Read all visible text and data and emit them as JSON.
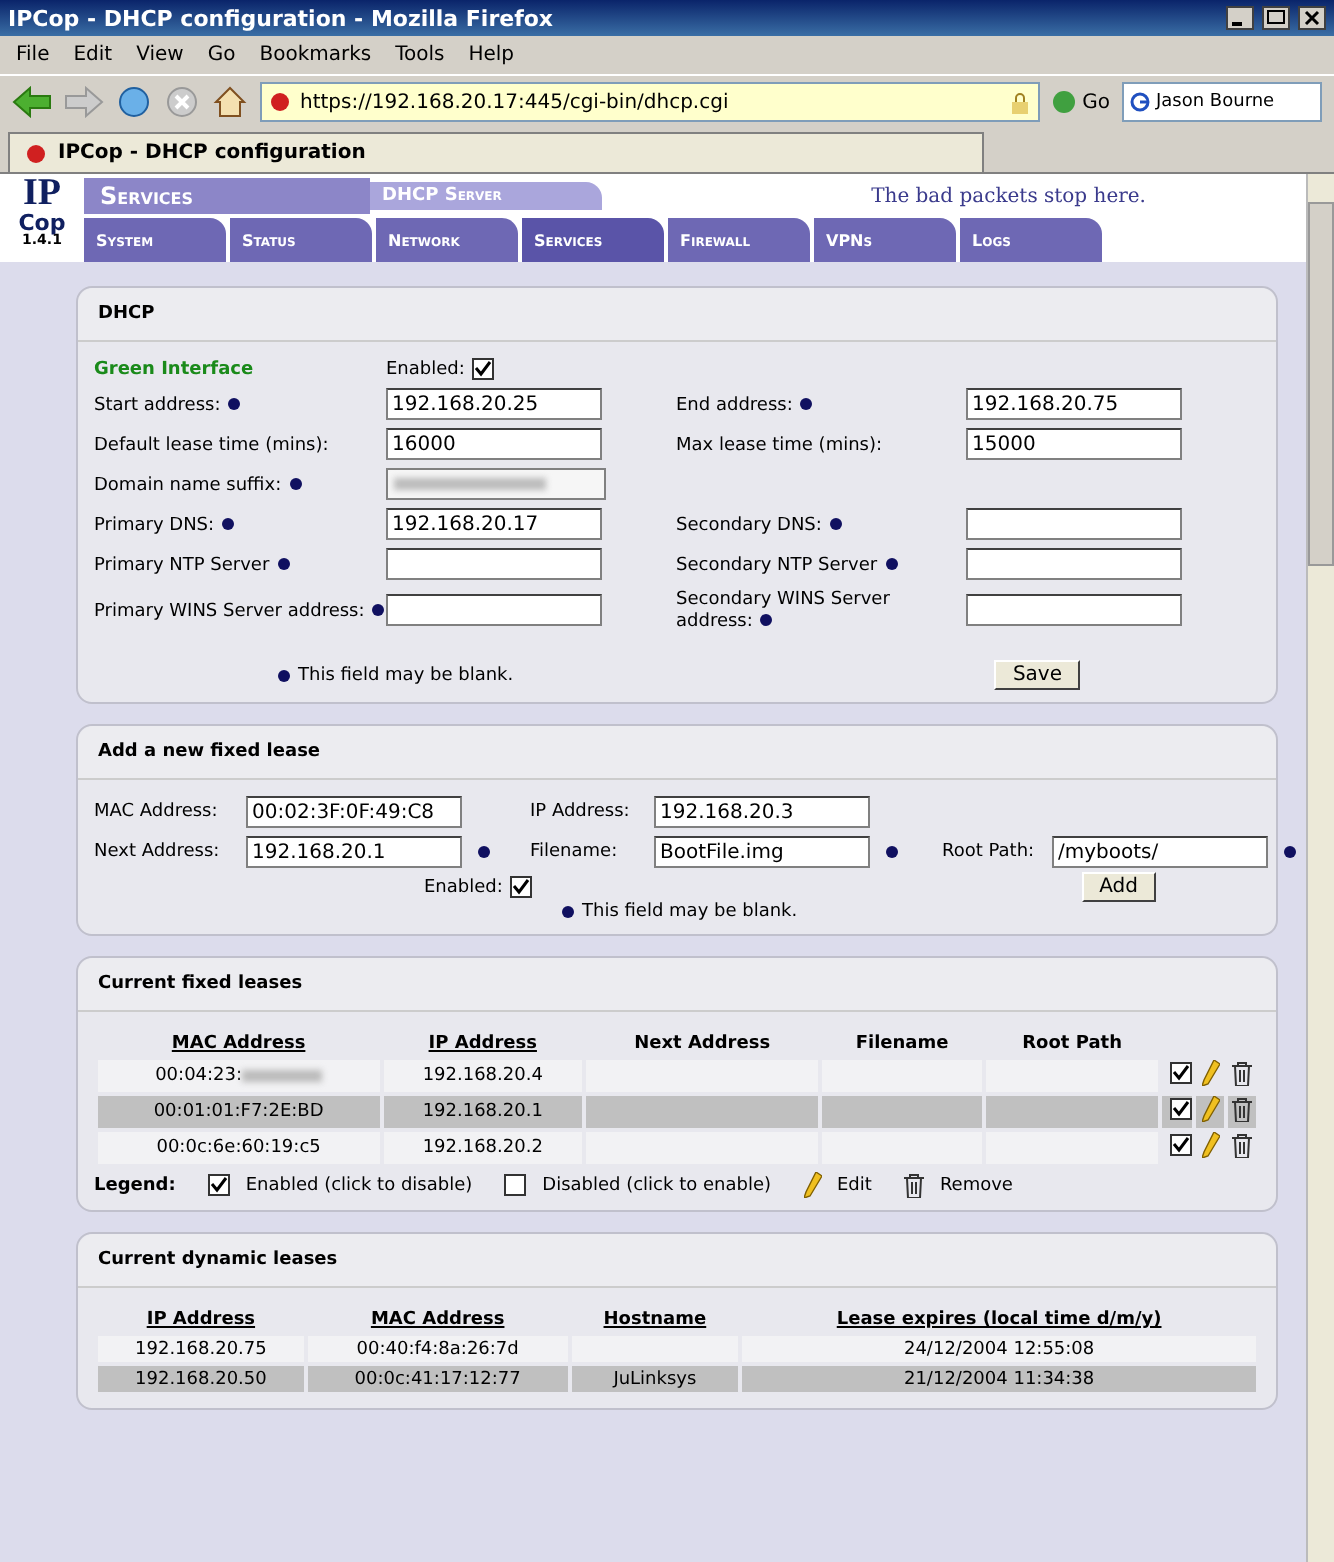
{
  "window": {
    "title": "IPCop - DHCP configuration - Mozilla Firefox"
  },
  "menu": [
    "File",
    "Edit",
    "View",
    "Go",
    "Bookmarks",
    "Tools",
    "Help"
  ],
  "toolbar": {
    "url": "https://192.168.20.17:445/cgi-bin/dhcp.cgi",
    "go": "Go",
    "search": "Jason Bourne"
  },
  "tabs": [
    {
      "label": "IPCop - DHCP configuration",
      "selected": true
    }
  ],
  "banner": {
    "logo_top": "IP",
    "logo_bottom": "Cop",
    "version": "1.4.1",
    "section": "Services",
    "subsection": "DHCP Server",
    "slogan": "The bad packets stop here.",
    "nav": [
      {
        "label": "System",
        "selected": false
      },
      {
        "label": "Status",
        "selected": false
      },
      {
        "label": "Network",
        "selected": false
      },
      {
        "label": "Services",
        "selected": true
      },
      {
        "label": "Firewall",
        "selected": false
      },
      {
        "label": "VPNs",
        "selected": false
      },
      {
        "label": "Logs",
        "selected": false
      }
    ]
  },
  "dhcp": {
    "title": "DHCP",
    "interface": "Green Interface",
    "enabled_label": "Enabled:",
    "enabled": true,
    "rows": [
      [
        {
          "label": "Start address:",
          "optional": true,
          "value": "192.168.20.25"
        },
        {
          "label": "End address:",
          "optional": true,
          "value": "192.168.20.75"
        }
      ],
      [
        {
          "label": "Default lease time (mins):",
          "value": "16000"
        },
        {
          "label": "Max lease time (mins):",
          "value": "15000"
        }
      ],
      [
        {
          "label": "Domain name suffix:",
          "optional": true,
          "blurred": true
        }
      ],
      [
        {
          "label": "Primary DNS:",
          "optional": true,
          "value": "192.168.20.17"
        },
        {
          "label": "Secondary DNS:",
          "optional": true
        }
      ],
      [
        {
          "label": "Primary NTP Server",
          "optional": true
        },
        {
          "label": "Secondary NTP Server",
          "optional": true
        }
      ],
      [
        {
          "label": "Primary WINS Server address:",
          "optional": true
        },
        {
          "label": "Secondary WINS Server address:",
          "optional": true
        }
      ]
    ],
    "note": "This field may be blank.",
    "save": "Save"
  },
  "fixed_form": {
    "title": "Add a new fixed lease",
    "fields": [
      {
        "label": "MAC Address:",
        "value": "00:02:3F:0F:49:C8"
      },
      {
        "label": "IP Address:",
        "value": "192.168.20.3"
      },
      {
        "label": "Next Address:",
        "value": "192.168.20.1",
        "optional": true
      },
      {
        "label": "Filename:",
        "value": "BootFile.img",
        "optional": true
      },
      {
        "label": "Root Path:",
        "value": "/myboots/",
        "optional": true
      }
    ],
    "enabled_label": "Enabled:",
    "enabled": true,
    "add": "Add",
    "note": "This field may be blank."
  },
  "fixed_leases": {
    "title": "Current fixed leases",
    "columns": [
      {
        "label": "MAC Address",
        "sortable": true
      },
      {
        "label": "IP Address",
        "sortable": true
      },
      {
        "label": "Next Address",
        "sortable": false
      },
      {
        "label": "Filename",
        "sortable": false
      },
      {
        "label": "Root Path",
        "sortable": false
      }
    ],
    "rows": [
      {
        "cells": [
          "00:04:23:",
          "192.168.20.4",
          "",
          "",
          ""
        ],
        "mac_blurred": true,
        "enabled": true,
        "selected": false
      },
      {
        "cells": [
          "00:01:01:F7:2E:BD",
          "192.168.20.1",
          "",
          "",
          ""
        ],
        "enabled": true,
        "selected": true
      },
      {
        "cells": [
          "00:0c:6e:60:19:c5",
          "192.168.20.2",
          "",
          "",
          ""
        ],
        "enabled": true,
        "selected": false
      }
    ],
    "legend": {
      "title": "Legend:",
      "items": [
        {
          "kind": "checkbox",
          "checked": true,
          "label": "Enabled (click to disable)"
        },
        {
          "kind": "checkbox",
          "checked": false,
          "label": "Disabled (click to enable)"
        },
        {
          "kind": "edit",
          "label": "Edit"
        },
        {
          "kind": "remove",
          "label": "Remove"
        }
      ]
    }
  },
  "dynamic_leases": {
    "title": "Current dynamic leases",
    "columns": [
      "IP Address",
      "MAC Address",
      "Hostname",
      "Lease expires (local time d/m/y)"
    ],
    "rows": [
      {
        "cells": [
          "192.168.20.75",
          "00:40:f4:8a:26:7d",
          "",
          "24/12/2004 12:55:08"
        ],
        "selected": false
      },
      {
        "cells": [
          "192.168.20.50",
          "00:0c:41:17:12:77",
          "JuLinksys",
          "21/12/2004 11:34:38"
        ],
        "selected": true
      }
    ]
  }
}
